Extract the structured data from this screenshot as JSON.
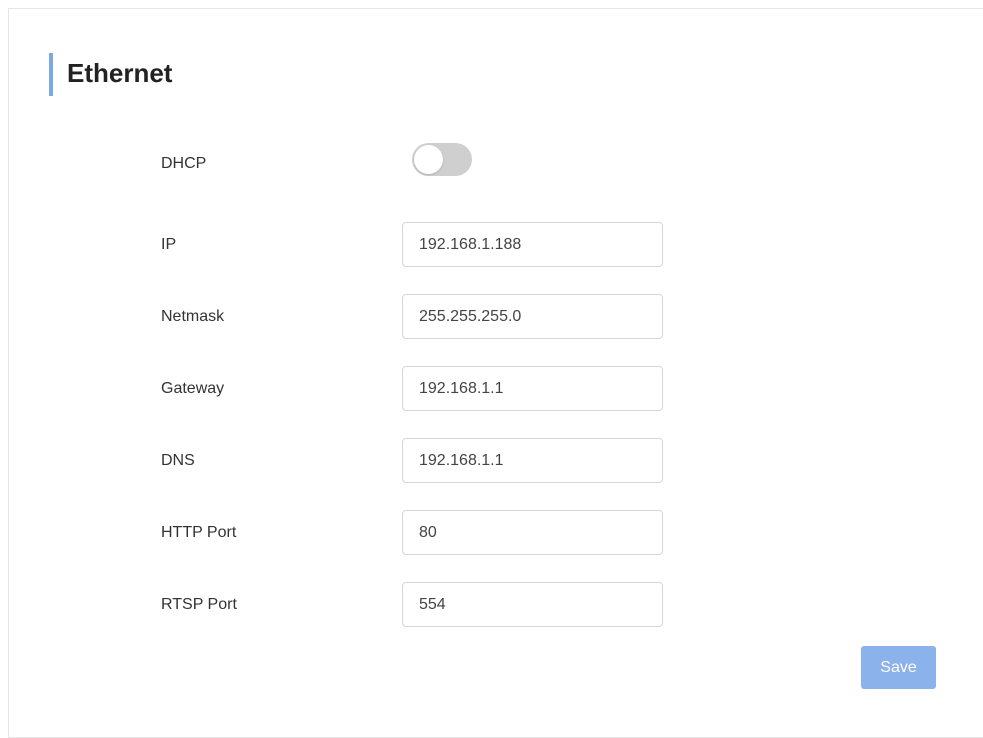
{
  "section": {
    "title": "Ethernet",
    "accent_color": "#7fa6e6"
  },
  "form": {
    "dhcp": {
      "label": "DHCP",
      "enabled": false
    },
    "ip": {
      "label": "IP",
      "value": "192.168.1.188"
    },
    "netmask": {
      "label": "Netmask",
      "value": "255.255.255.0"
    },
    "gateway": {
      "label": "Gateway",
      "value": "192.168.1.1"
    },
    "dns": {
      "label": "DNS",
      "value": "192.168.1.1"
    },
    "http_port": {
      "label": "HTTP Port",
      "value": "80"
    },
    "rtsp_port": {
      "label": "RTSP Port",
      "value": "554"
    }
  },
  "actions": {
    "save_label": "Save",
    "save_color": "#8cb2ec"
  }
}
